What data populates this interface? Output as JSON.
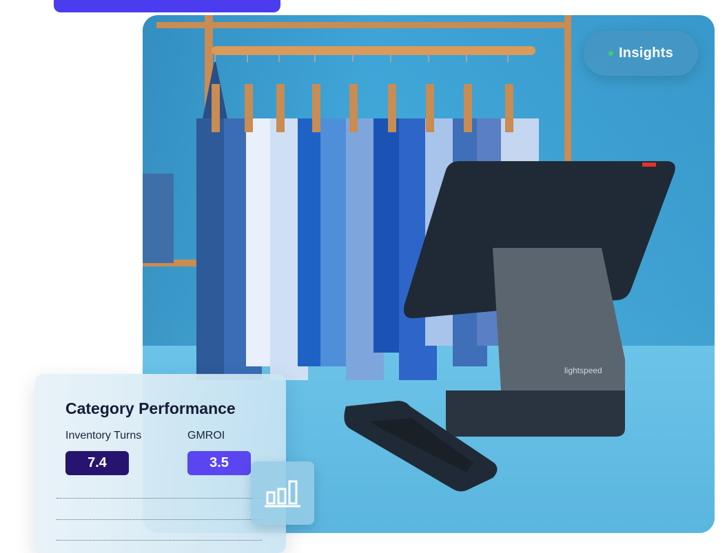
{
  "badge": {
    "label": "Insights",
    "icon": "status-dot-icon",
    "dot_color": "#3fd06b"
  },
  "card": {
    "title": "Category Performance",
    "metrics": [
      {
        "label": "Inventory Turns",
        "value": "7.4",
        "color": "#26146e"
      },
      {
        "label": "GMROI",
        "value": "3.5",
        "color": "#5a45f0"
      }
    ]
  },
  "chart_button": {
    "icon": "bar-chart-icon"
  },
  "photo": {
    "brand_mark": "lightspeed"
  },
  "colors": {
    "accent": "#4b3cf0",
    "background": "#ffffff"
  }
}
